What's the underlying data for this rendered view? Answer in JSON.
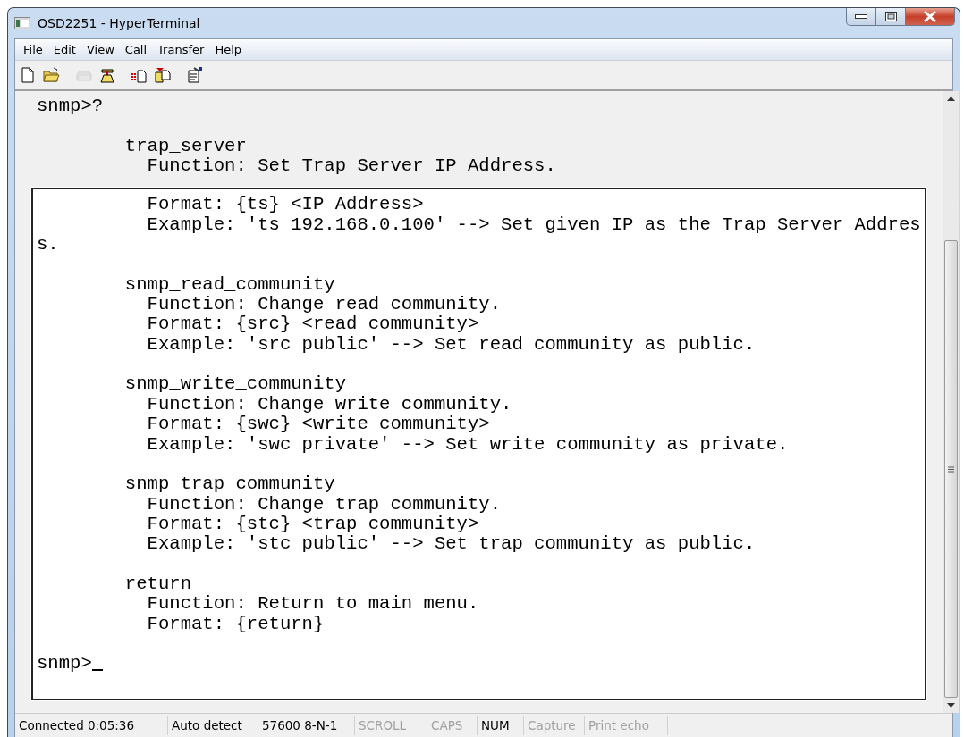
{
  "window": {
    "title": "OSD2251 - HyperTerminal"
  },
  "menu": [
    "File",
    "Edit",
    "View",
    "Call",
    "Transfer",
    "Help"
  ],
  "toolbar": [
    {
      "kind": "new",
      "disabled": false
    },
    {
      "kind": "open",
      "disabled": false
    },
    {
      "kind": "call",
      "disabled": true
    },
    {
      "kind": "dial",
      "disabled": false
    },
    {
      "kind": "send",
      "disabled": false
    },
    {
      "kind": "receive",
      "disabled": false
    },
    {
      "kind": "properties",
      "disabled": false
    }
  ],
  "terminal": {
    "scrollback": [
      [
        {
          "kind": "prompt",
          "text": "snmp>?"
        }
      ],
      [
        {
          "kind": "command",
          "text": "trap_server"
        },
        {
          "kind": "detail",
          "text": "Function: Set Trap Server IP Address."
        }
      ]
    ],
    "screen": [
      [
        {
          "kind": "detail",
          "text": "Format: {ts} <IP Address>"
        },
        {
          "kind": "detail",
          "text": "Example: 'ts 192.168.0.100' --> Set given IP as the Trap Server Addres"
        },
        {
          "kind": "wrap",
          "text": "s."
        }
      ],
      [
        {
          "kind": "command",
          "text": "snmp_read_community"
        },
        {
          "kind": "detail",
          "text": "Function: Change read community."
        },
        {
          "kind": "detail",
          "text": "Format: {src} <read community>"
        },
        {
          "kind": "detail",
          "text": "Example: 'src public' --> Set read community as public."
        }
      ],
      [
        {
          "kind": "command",
          "text": "snmp_write_community"
        },
        {
          "kind": "detail",
          "text": "Function: Change write community."
        },
        {
          "kind": "detail",
          "text": "Format: {swc} <write community>"
        },
        {
          "kind": "detail",
          "text": "Example: 'swc private' --> Set write community as private."
        }
      ],
      [
        {
          "kind": "command",
          "text": "snmp_trap_community"
        },
        {
          "kind": "detail",
          "text": "Function: Change trap community."
        },
        {
          "kind": "detail",
          "text": "Format: {stc} <trap community>"
        },
        {
          "kind": "detail",
          "text": "Example: 'stc public' --> Set trap community as public."
        }
      ],
      [
        {
          "kind": "command",
          "text": "return"
        },
        {
          "kind": "detail",
          "text": "Function: Return to main menu."
        },
        {
          "kind": "detail",
          "text": "Format: {return}"
        }
      ],
      [
        {
          "kind": "prompt",
          "text": "snmp>"
        }
      ]
    ],
    "cursor_visible": true
  },
  "status_bar": [
    {
      "text": "Connected 0:05:36",
      "disabled": false
    },
    {
      "text": "Auto detect",
      "disabled": false
    },
    {
      "text": "57600 8-N-1",
      "disabled": false
    },
    {
      "text": "SCROLL",
      "disabled": true
    },
    {
      "text": "CAPS",
      "disabled": true
    },
    {
      "text": "NUM",
      "disabled": false
    },
    {
      "text": "Capture",
      "disabled": true
    },
    {
      "text": "Print echo",
      "disabled": true
    }
  ]
}
